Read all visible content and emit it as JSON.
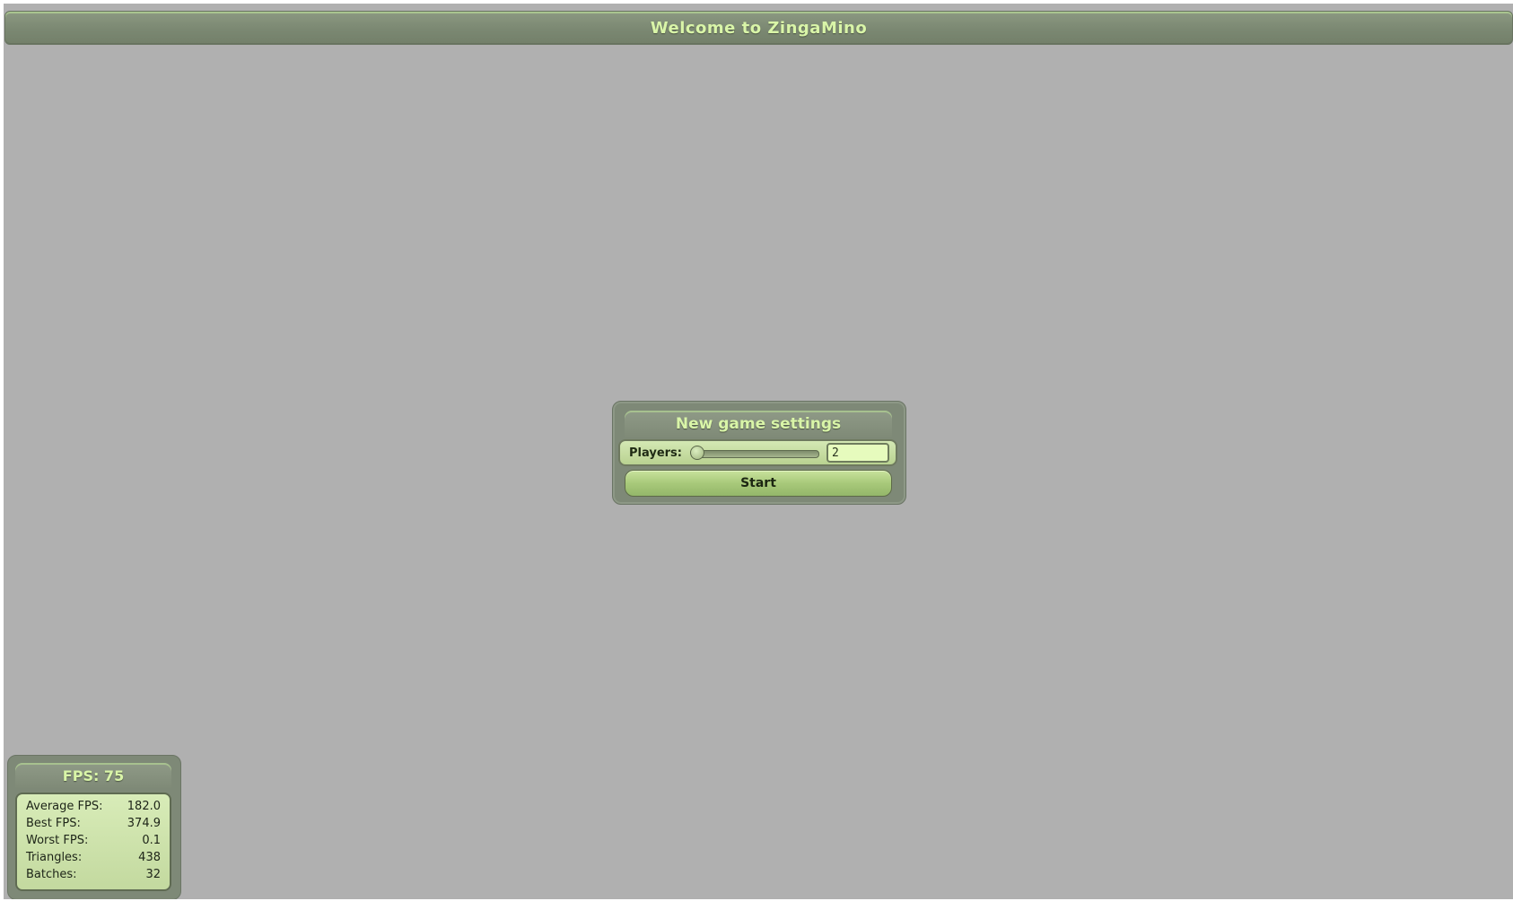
{
  "window": {
    "title": "Welcome to ZingaMino"
  },
  "settings": {
    "title": "New game settings",
    "players_label": "Players:",
    "players_value": "2",
    "start_label": "Start"
  },
  "fps": {
    "title": "FPS: 75",
    "stats": [
      {
        "label": "Average FPS:",
        "value": "182.0"
      },
      {
        "label": "Best FPS:",
        "value": "374.9"
      },
      {
        "label": "Worst FPS:",
        "value": "0.1"
      },
      {
        "label": "Triangles:",
        "value": "438"
      },
      {
        "label": "Batches:",
        "value": "32"
      }
    ]
  },
  "colors": {
    "background": "#b0b0b0",
    "panel": "#7e8977",
    "title_text": "#d9f5a8",
    "accent_green": "#a8c97a"
  }
}
